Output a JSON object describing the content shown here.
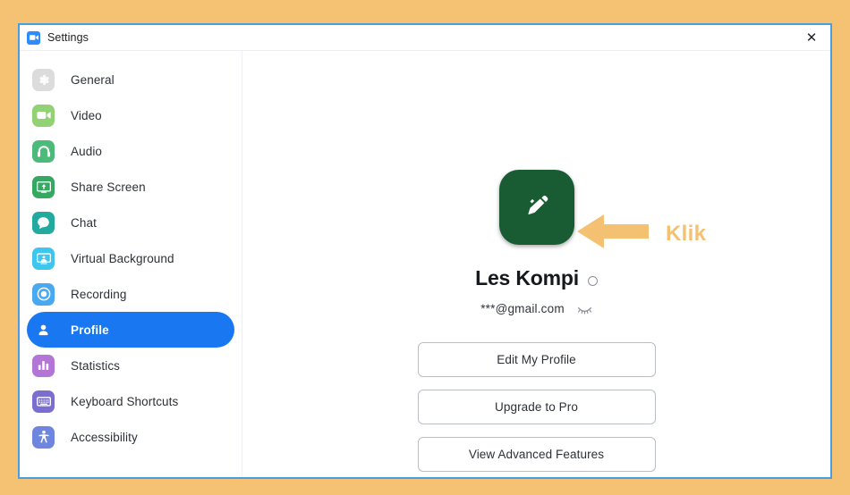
{
  "window": {
    "title": "Settings",
    "logo_icon": "zoom-video-icon",
    "close_label": "✕",
    "border_color": "#4a9ee0",
    "page_background": "#f5c274"
  },
  "sidebar": {
    "items": [
      {
        "label": "General",
        "icon": "gear-icon",
        "color": "#dcdcdc",
        "active": false
      },
      {
        "label": "Video",
        "icon": "video-camera-icon",
        "color": "#92d274",
        "active": false
      },
      {
        "label": "Audio",
        "icon": "headphones-icon",
        "color": "#4cba79",
        "active": false
      },
      {
        "label": "Share Screen",
        "icon": "share-screen-icon",
        "color": "#35a862",
        "active": false
      },
      {
        "label": "Chat",
        "icon": "chat-bubble-icon",
        "color": "#22a9a0",
        "active": false
      },
      {
        "label": "Virtual Background",
        "icon": "virtual-background-icon",
        "color": "#3ec6ef",
        "active": false
      },
      {
        "label": "Recording",
        "icon": "recording-icon",
        "color": "#49a9f0",
        "active": false
      },
      {
        "label": "Profile",
        "icon": "person-icon",
        "color": "#1977f2",
        "active": true
      },
      {
        "label": "Statistics",
        "icon": "bar-chart-icon",
        "color": "#b375d6",
        "active": false
      },
      {
        "label": "Keyboard Shortcuts",
        "icon": "keyboard-icon",
        "color": "#7a6fd1",
        "active": false
      },
      {
        "label": "Accessibility",
        "icon": "accessibility-icon",
        "color": "#6f86de",
        "active": false
      }
    ],
    "active_color": "#1977f2"
  },
  "profile": {
    "avatar_icon": "pencil-edit-icon",
    "avatar_color": "#195b33",
    "display_name": "Les Kompi",
    "name_edit_icon": "edit-circle-icon",
    "email": "***@gmail.com",
    "email_toggle_icon": "eye-closed-icon",
    "buttons": [
      {
        "label": "Edit My Profile"
      },
      {
        "label": "Upgrade to Pro"
      },
      {
        "label": "View Advanced Features"
      }
    ]
  },
  "annotation": {
    "label": "Klik",
    "arrow_icon": "arrow-left-icon",
    "color": "#f4c173"
  }
}
